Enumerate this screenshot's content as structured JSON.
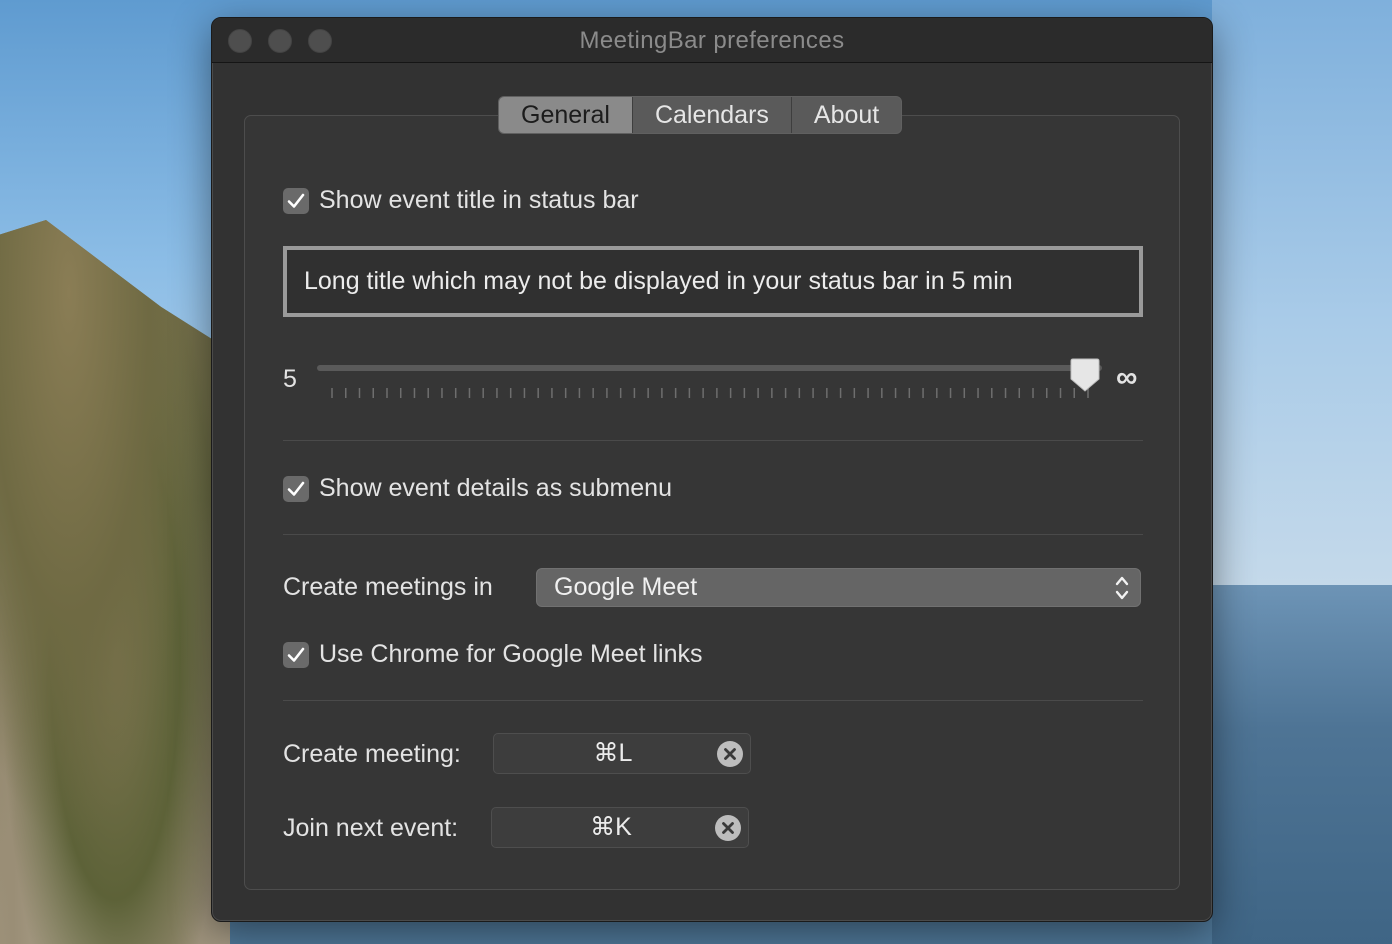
{
  "window": {
    "title": "MeetingBar preferences"
  },
  "tabs": [
    {
      "label": "General",
      "active": true
    },
    {
      "label": "Calendars",
      "active": false
    },
    {
      "label": "About",
      "active": false
    }
  ],
  "general": {
    "show_title_label": "Show event title in status bar",
    "show_title_checked": true,
    "title_preview": "Long title which may not be displayed in your status bar in 5 min",
    "slider": {
      "min_label": "5",
      "max_label": "∞",
      "value_fraction": 1.0
    },
    "show_details_label": "Show event details as submenu",
    "show_details_checked": true,
    "create_meetings_label": "Create meetings in",
    "create_meetings_value": "Google Meet",
    "use_chrome_label": "Use Chrome for Google Meet links",
    "use_chrome_checked": true,
    "create_meeting_label": "Create meeting:",
    "create_meeting_shortcut": "⌘L",
    "join_next_label": "Join next event:",
    "join_next_shortcut": "⌘K"
  },
  "colors": {
    "window_bg": "#323232",
    "checkbox_bg": "#6a6a6a",
    "active_tab_bg": "#8a8a8a"
  }
}
